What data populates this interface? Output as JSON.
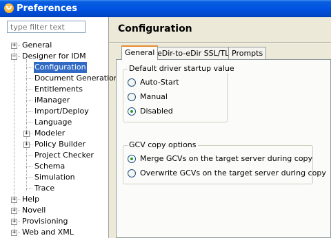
{
  "window": {
    "title": "Preferences"
  },
  "filter": {
    "placeholder": "type filter text"
  },
  "tree": [
    {
      "label": "General",
      "level": 0,
      "expander": "+"
    },
    {
      "label": "Designer for IDM",
      "level": 0,
      "expander": "-"
    },
    {
      "label": "Configuration",
      "level": 1,
      "expander": "",
      "selected": true
    },
    {
      "label": "Document Generation",
      "level": 1,
      "expander": ""
    },
    {
      "label": "Entitlements",
      "level": 1,
      "expander": ""
    },
    {
      "label": "iManager",
      "level": 1,
      "expander": ""
    },
    {
      "label": "Import/Deploy",
      "level": 1,
      "expander": ""
    },
    {
      "label": "Language",
      "level": 1,
      "expander": ""
    },
    {
      "label": "Modeler",
      "level": 1,
      "expander": "+"
    },
    {
      "label": "Policy Builder",
      "level": 1,
      "expander": "+"
    },
    {
      "label": "Project Checker",
      "level": 1,
      "expander": ""
    },
    {
      "label": "Schema",
      "level": 1,
      "expander": ""
    },
    {
      "label": "Simulation",
      "level": 1,
      "expander": ""
    },
    {
      "label": "Trace",
      "level": 1,
      "expander": ""
    },
    {
      "label": "Help",
      "level": 0,
      "expander": "+"
    },
    {
      "label": "Novell",
      "level": 0,
      "expander": "+"
    },
    {
      "label": "Provisioning",
      "level": 0,
      "expander": "+"
    },
    {
      "label": "Web and XML",
      "level": 0,
      "expander": "+"
    }
  ],
  "page": {
    "title": "Configuration"
  },
  "tabs": [
    {
      "label": "General",
      "active": true
    },
    {
      "label": "eDir-to-eDir SSL/TLS",
      "active": false
    },
    {
      "label": "Prompts",
      "active": false
    }
  ],
  "startup_group": {
    "legend": "Default driver startup value",
    "options": [
      {
        "label": "Auto-Start",
        "checked": false
      },
      {
        "label": "Manual",
        "checked": false
      },
      {
        "label": "Disabled",
        "checked": true
      }
    ]
  },
  "gcv_group": {
    "legend": "GCV copy options",
    "options": [
      {
        "label": "Merge GCVs on the target server during copy",
        "checked": true
      },
      {
        "label": "Overwrite GCVs on the target server during copy",
        "checked": false
      }
    ]
  },
  "colors": {
    "title_bar": "#0053e1",
    "selection": "#316ac5",
    "active_tab_accent": "#e68b2c",
    "radio_dot": "#21a121"
  }
}
